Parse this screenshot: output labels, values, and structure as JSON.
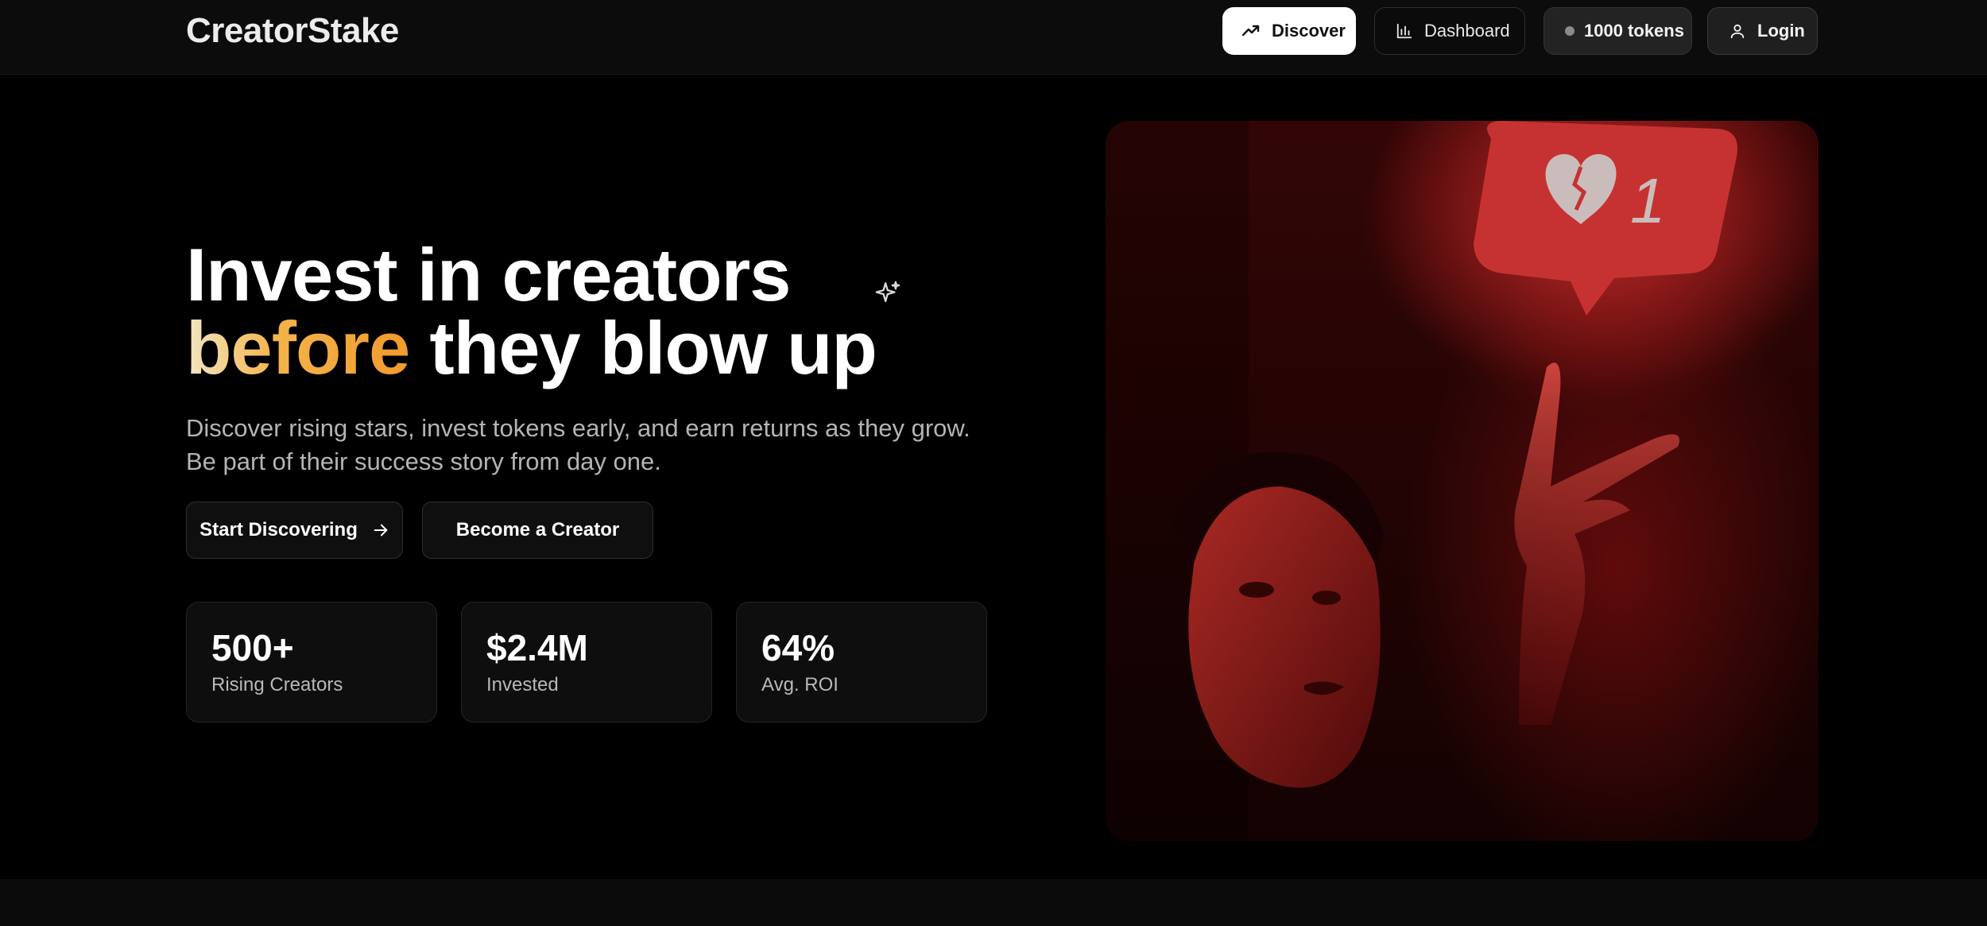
{
  "header": {
    "brand": "CreatorStake",
    "nav": {
      "discover": "Discover",
      "dashboard": "Dashboard",
      "tokens": "1000 tokens",
      "login": "Login"
    }
  },
  "hero": {
    "headline_line1": "Invest in creators",
    "headline_accent": "before",
    "headline_line2_rest": " they blow up",
    "subtitle": "Discover rising stars, invest tokens early, and earn returns as they grow. Be part of their success story from day one.",
    "cta_primary": "Start Discovering",
    "cta_secondary": "Become a Creator",
    "notification_count": "1"
  },
  "stats": [
    {
      "value": "500+",
      "label": "Rising Creators"
    },
    {
      "value": "$2.4M",
      "label": "Invested"
    },
    {
      "value": "64%",
      "label": "Avg. ROI"
    }
  ],
  "icons": {
    "discover": "trending-up-icon",
    "dashboard": "bar-chart-icon",
    "tokens": "dot-icon",
    "login": "user-icon",
    "sparkle": "sparkle-icon",
    "arrow": "arrow-right-icon",
    "heart": "broken-heart-icon"
  },
  "colors": {
    "accent_gradient_start": "#f4e6c4",
    "accent_gradient_mid": "#f3b44a",
    "accent_gradient_end": "#f29a2e",
    "background": "#000000",
    "notification_red": "#e23a3a"
  }
}
